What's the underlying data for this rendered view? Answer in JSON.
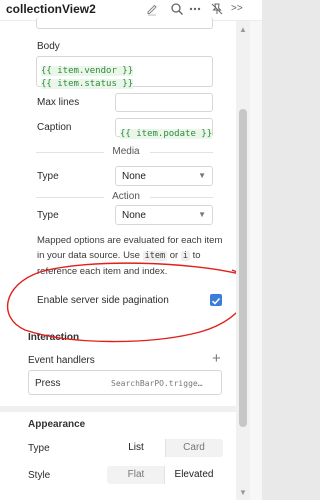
{
  "header": {
    "title": "collectionView2",
    "more": ">>"
  },
  "body_field": {
    "label": "Body",
    "line1": "{{ item.vendor }}",
    "line2": "{{ item.status }}"
  },
  "max_lines": {
    "label": "Max lines",
    "value": ""
  },
  "caption": {
    "label": "Caption",
    "value": "{{ item.podate }}"
  },
  "media": {
    "heading": "Media",
    "type_label": "Type",
    "value": "None"
  },
  "action": {
    "heading": "Action",
    "type_label": "Type",
    "value": "None"
  },
  "info": {
    "t1": "Mapped options are evaluated for each item in your data source. Use",
    "chip1": "item",
    "t2": "or",
    "chip2": "i",
    "t3": "to reference each item and index."
  },
  "pagination": {
    "label": "Enable server side pagination",
    "checked": true,
    "annotation_color": "#e0201a"
  },
  "interaction": {
    "heading": "Interaction",
    "event_handlers_label": "Event handlers",
    "add": "+",
    "event": "Press",
    "handler": "SearchBarPO.trigge…"
  },
  "appearance": {
    "heading": "Appearance",
    "type_label": "Type",
    "type_options": [
      "List",
      "Card"
    ],
    "type_selected": "List",
    "style_label": "Style",
    "style_options": [
      "Flat",
      "Elevated"
    ],
    "style_selected": "Elevated"
  },
  "colors": {
    "accent": "#3b7ddd",
    "code": "#2f8a3a"
  }
}
